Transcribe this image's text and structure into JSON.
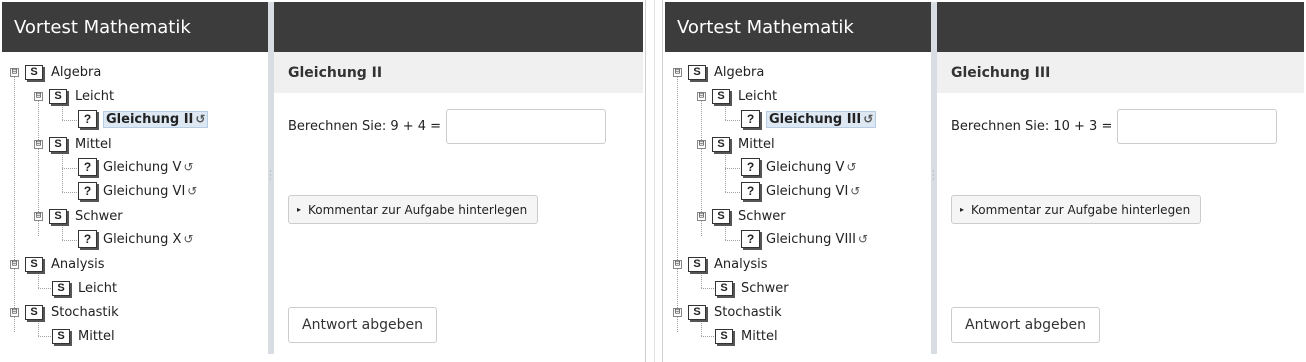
{
  "screenshots": [
    {
      "app_title": "Vortest Mathematik",
      "tree": {
        "algebra": "Algebra",
        "leicht": "Leicht",
        "q1": "Gleichung II",
        "mittel": "Mittel",
        "q2": "Gleichung V",
        "q3": "Gleichung VI",
        "schwer": "Schwer",
        "q4": "Gleichung X",
        "analysis": "Analysis",
        "analysis_child": "Leicht",
        "stochastik": "Stochastik",
        "stochastik_child": "Mittel"
      },
      "question": {
        "title": "Gleichung II",
        "prompt": "Berechnen Sie: 9 + 4 =",
        "answer_value": "",
        "comment_label": "Kommentar zur Aufgabe hinterlegen",
        "submit_label": "Antwort abgeben"
      }
    },
    {
      "app_title": "Vortest Mathematik",
      "tree": {
        "algebra": "Algebra",
        "leicht": "Leicht",
        "q1": "Gleichung III",
        "mittel": "Mittel",
        "q2": "Gleichung V",
        "q3": "Gleichung VI",
        "schwer": "Schwer",
        "q4": "Gleichung VIII",
        "analysis": "Analysis",
        "analysis_child": "Schwer",
        "stochastik": "Stochastik",
        "stochastik_child": "Mittel"
      },
      "question": {
        "title": "Gleichung III",
        "prompt": "Berechnen Sie: 10 + 3 =",
        "answer_value": "",
        "comment_label": "Kommentar zur Aufgabe hinterlegen",
        "submit_label": "Antwort abgeben"
      }
    }
  ],
  "icons": {
    "collapse": "⊟",
    "section": "S",
    "question": "?",
    "reload": "↺",
    "expand_triangle": "▸"
  },
  "colors": {
    "title_bar": "#3c3c3c",
    "selected_bg": "#dde8f3",
    "question_header_bg": "#f0f0f0"
  }
}
